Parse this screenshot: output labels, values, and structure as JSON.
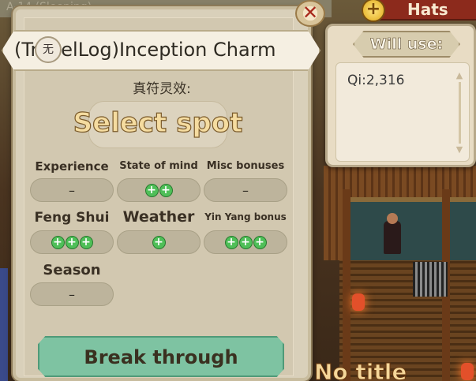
{
  "background": {
    "window_label": "A-14 (Sleeping)",
    "banner": "No title"
  },
  "hats": {
    "label": "Hats",
    "add_symbol": "+"
  },
  "will_use": {
    "title": "Will use:",
    "qi_text": "Qi:2,316"
  },
  "panel": {
    "title": "(TravelLog)Inception Charm",
    "badge": "无",
    "close_symbol": "✕",
    "subtitle": "真符灵效:",
    "select_spot": "Select spot",
    "stats": [
      {
        "label": "Experience",
        "value": "–",
        "pluses": 0
      },
      {
        "label": "State of mind",
        "value": "",
        "pluses": 2
      },
      {
        "label": "Misc bonuses",
        "value": "–",
        "pluses": 0
      },
      {
        "label": "Feng Shui",
        "value": "",
        "pluses": 3
      },
      {
        "label": "Weather",
        "value": "",
        "pluses": 1
      },
      {
        "label": "Yin Yang bonus",
        "value": "",
        "pluses": 3
      },
      {
        "label": "Season",
        "value": "–",
        "pluses": 0
      }
    ],
    "action_button": "Break through"
  },
  "colors": {
    "plus_green": "#4fbf58",
    "button_teal": "#7ec3a2",
    "close_red": "#a8291c",
    "hats_bar": "#8c2a1c"
  }
}
